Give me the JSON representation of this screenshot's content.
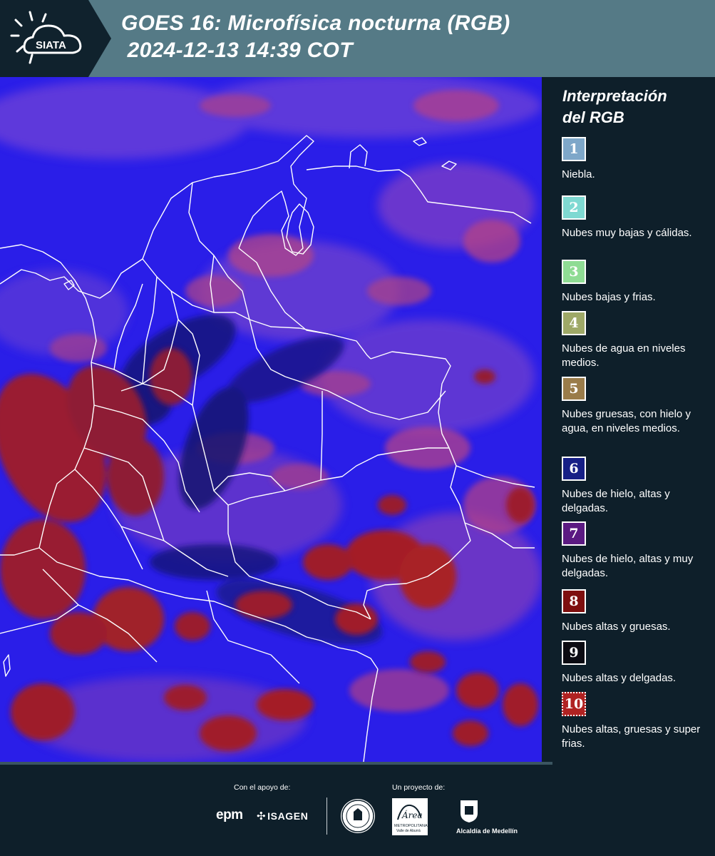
{
  "header": {
    "logo_text": "SIATA",
    "title_line1": "GOES 16: Microfísica nocturna (RGB)",
    "title_line2": " 2024-12-13 14:39 COT"
  },
  "map": {
    "base_color": "#2a1ee8",
    "border_color": "#ffffff"
  },
  "legend": {
    "title_line1": "Interpretación",
    "title_line2": "del RGB",
    "items": [
      {
        "number": "1",
        "label": "Niebla.",
        "color": "#7ea7c9"
      },
      {
        "number": "2",
        "label": "Nubes muy bajas y cálidas.",
        "color": "#7fd9d2"
      },
      {
        "number": "3",
        "label": "Nubes bajas y frias.",
        "color": "#8fdc94"
      },
      {
        "number": "4",
        "label": "Nubes de agua en niveles medios.",
        "color": "#9ea867"
      },
      {
        "number": "5",
        "label": "Nubes gruesas, con hielo y agua, en niveles medios.",
        "color": "#9a7c4a"
      },
      {
        "number": "6",
        "label": "Nubes de hielo, altas y delgadas.",
        "color": "#161f86"
      },
      {
        "number": "7",
        "label": "Nubes de hielo, altas y muy delgadas.",
        "color": "#5b1a82"
      },
      {
        "number": "8",
        "label": "Nubes altas y gruesas.",
        "color": "#7e0f0f"
      },
      {
        "number": "9",
        "label": "Nubes altas y delgadas.",
        "color": "#0b0b12"
      },
      {
        "number": "10",
        "label": "Nubes altas, gruesas y super frias.",
        "color": "#b02222"
      }
    ]
  },
  "footer": {
    "support_label": "Con el apoyo de:",
    "project_label": "Un proyecto de:",
    "epm": "epm",
    "isagen": "ISAGEN",
    "area_line1": "METROPOLITANA",
    "area_line2": "Valle de Aburrá",
    "alcaldia": "Alcaldía de Medellín"
  }
}
